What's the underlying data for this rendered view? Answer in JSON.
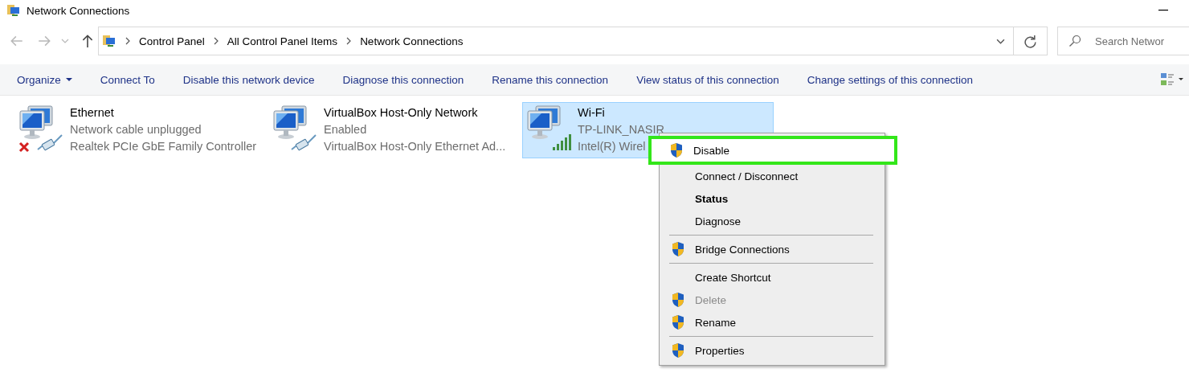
{
  "window": {
    "title": "Network Connections"
  },
  "address": {
    "breadcrumbs": [
      "Control Panel",
      "All Control Panel Items",
      "Network Connections"
    ]
  },
  "search": {
    "placeholder": "Search Networ"
  },
  "toolbar": [
    {
      "label": "Organize",
      "dropdown": true
    },
    {
      "label": "Connect To",
      "dropdown": false
    },
    {
      "label": "Disable this network device",
      "dropdown": false
    },
    {
      "label": "Diagnose this connection",
      "dropdown": false
    },
    {
      "label": "Rename this connection",
      "dropdown": false
    },
    {
      "label": "View status of this connection",
      "dropdown": false
    },
    {
      "label": "Change settings of this connection",
      "dropdown": false
    }
  ],
  "connections": [
    {
      "name": "Ethernet",
      "status": "Network cable unplugged",
      "device": "Realtek PCIe GbE Family Controller",
      "selected": false,
      "kind": "cable",
      "disconnected": true
    },
    {
      "name": "VirtualBox Host-Only Network",
      "status": "Enabled",
      "device": "VirtualBox Host-Only Ethernet Ad...",
      "selected": false,
      "kind": "cable",
      "disconnected": false
    },
    {
      "name": "Wi-Fi",
      "status": "TP-LINK_NASIR",
      "device": "Intel(R) Wirel",
      "selected": true,
      "kind": "wireless",
      "disconnected": false
    }
  ],
  "context_menu": {
    "groups": [
      [
        {
          "label": "Disable",
          "shield": true,
          "bold": false,
          "disabled": false,
          "highlighted": true
        },
        {
          "label": "Connect / Disconnect",
          "shield": false,
          "bold": false,
          "disabled": false,
          "highlighted": false
        },
        {
          "label": "Status",
          "shield": false,
          "bold": true,
          "disabled": false,
          "highlighted": false
        },
        {
          "label": "Diagnose",
          "shield": false,
          "bold": false,
          "disabled": false,
          "highlighted": false
        }
      ],
      [
        {
          "label": "Bridge Connections",
          "shield": true,
          "bold": false,
          "disabled": false,
          "highlighted": false
        }
      ],
      [
        {
          "label": "Create Shortcut",
          "shield": false,
          "bold": false,
          "disabled": false,
          "highlighted": false
        },
        {
          "label": "Delete",
          "shield": true,
          "bold": false,
          "disabled": true,
          "highlighted": false
        },
        {
          "label": "Rename",
          "shield": true,
          "bold": false,
          "disabled": false,
          "highlighted": false
        }
      ],
      [
        {
          "label": "Properties",
          "shield": true,
          "bold": false,
          "disabled": false,
          "highlighted": false
        }
      ]
    ]
  }
}
